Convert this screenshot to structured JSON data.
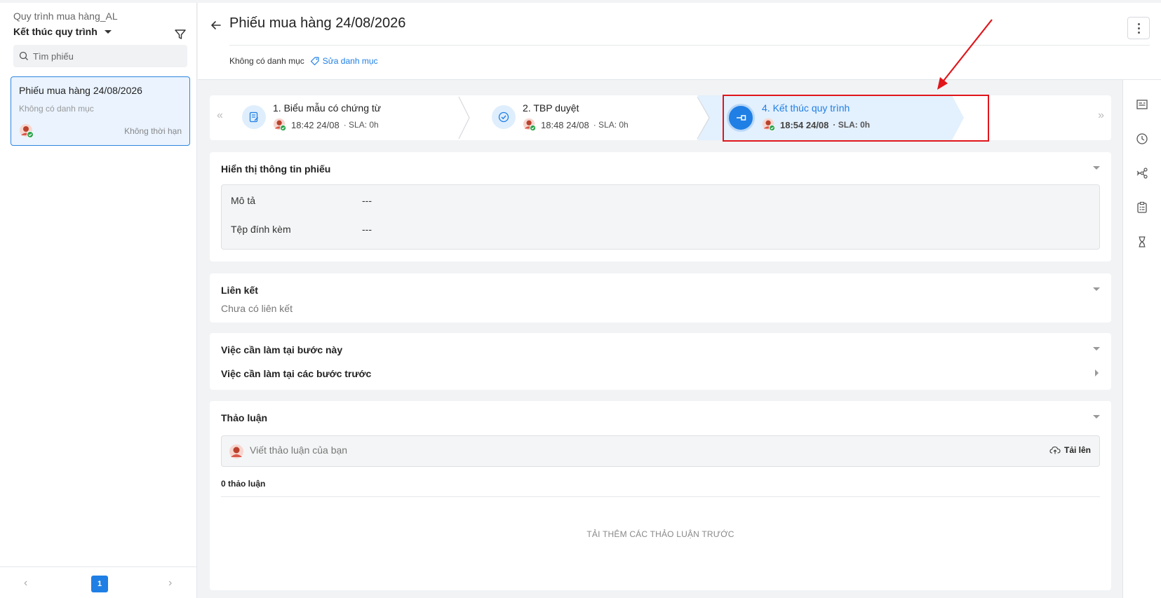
{
  "sidebar": {
    "process_name": "Quy trình mua hàng_AL",
    "status_filter": "Kết thúc quy trình",
    "search_placeholder": "Tìm phiếu",
    "ticket": {
      "title": "Phiếu mua hàng 24/08/2026",
      "category": "Không có danh mục",
      "deadline": "Không thời hạn"
    },
    "pagination": {
      "prev": "‹",
      "current": "1",
      "next": "›"
    }
  },
  "header": {
    "title": "Phiếu mua hàng 24/08/2026",
    "category": "Không có danh mục",
    "edit_category": "Sửa danh mục"
  },
  "stepper": {
    "prev": "«",
    "next": "»",
    "steps": [
      {
        "title": "1. Biểu mẫu có chứng từ",
        "time": "18:42 24/08",
        "sla": "· SLA: 0h",
        "icon": "form-icon",
        "active": false
      },
      {
        "title": "2. TBP duyệt",
        "time": "18:48 24/08",
        "sla": "· SLA: 0h",
        "icon": "check-circle-icon",
        "active": false
      },
      {
        "title": "4. Kết thúc quy trình",
        "time": "18:54 24/08",
        "sla": "· SLA: 0h",
        "icon": "end-process-icon",
        "active": true
      }
    ]
  },
  "sections": {
    "info": {
      "title": "Hiển thị thông tin phiếu",
      "fields": [
        {
          "label": "Mô tả",
          "value": "---"
        },
        {
          "label": "Tệp đính kèm",
          "value": "---"
        }
      ]
    },
    "links": {
      "title": "Liên kết",
      "empty": "Chưa có liên kết"
    },
    "todo": {
      "current_title": "Việc cần làm tại bước này",
      "previous_title": "Việc cần làm tại các bước trước"
    },
    "discussion": {
      "title": "Thảo luận",
      "placeholder": "Viết thảo luận của bạn",
      "upload": "Tải lên",
      "count": "0 thảo luận",
      "load_more": "TẢI THÊM CÁC THẢO LUẬN TRƯỚC"
    }
  },
  "right_rail": {
    "icons": [
      "details-icon",
      "clock-icon",
      "workflow-icon",
      "task-list-icon",
      "hourglass-icon"
    ]
  },
  "colors": {
    "accent": "#1f7fe5",
    "highlight": "#e0161b",
    "active_step_bg": "#e3f0fd"
  }
}
